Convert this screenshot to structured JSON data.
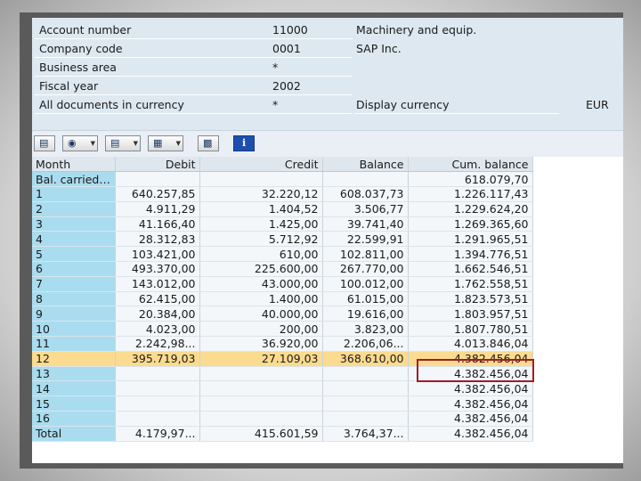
{
  "header": {
    "rows": [
      {
        "label": "Account number",
        "value": "11000",
        "desc": "Machinery and equip."
      },
      {
        "label": "Company code",
        "value": "0001",
        "desc": "SAP Inc."
      },
      {
        "label": "Business area",
        "value": "*",
        "desc": ""
      },
      {
        "label": "Fiscal year",
        "value": "2002",
        "desc": ""
      },
      {
        "label": "All documents in currency",
        "value": "*",
        "desc": "Display currency"
      }
    ],
    "currency": "EUR"
  },
  "toolbar": {
    "icons": [
      "detail-view-icon",
      "filter-icon",
      "export-icon",
      "layout-icon",
      "graphic-icon",
      "info-icon"
    ]
  },
  "table": {
    "columns": [
      "Month",
      "Debit",
      "Credit",
      "Balance",
      "Cum. balance"
    ],
    "rows": [
      [
        "Bal. carried…",
        "",
        "",
        "",
        "618.079,70"
      ],
      [
        "1",
        "640.257,85",
        "32.220,12",
        "608.037,73",
        "1.226.117,43"
      ],
      [
        "2",
        "4.911,29",
        "1.404,52",
        "3.506,77",
        "1.229.624,20"
      ],
      [
        "3",
        "41.166,40",
        "1.425,00",
        "39.741,40",
        "1.269.365,60"
      ],
      [
        "4",
        "28.312,83",
        "5.712,92",
        "22.599,91",
        "1.291.965,51"
      ],
      [
        "5",
        "103.421,00",
        "610,00",
        "102.811,00",
        "1.394.776,51"
      ],
      [
        "6",
        "493.370,00",
        "225.600,00",
        "267.770,00",
        "1.662.546,51"
      ],
      [
        "7",
        "143.012,00",
        "43.000,00",
        "100.012,00",
        "1.762.558,51"
      ],
      [
        "8",
        "62.415,00",
        "1.400,00",
        "61.015,00",
        "1.823.573,51"
      ],
      [
        "9",
        "20.384,00",
        "40.000,00",
        "19.616,00",
        "1.803.957,51"
      ],
      [
        "10",
        "4.023,00",
        "200,00",
        "3.823,00",
        "1.807.780,51"
      ],
      [
        "11",
        "2.242,98...",
        "36.920,00",
        "2.206,06...",
        "4.013.846,04"
      ],
      [
        "12",
        "395.719,03",
        "27.109,03",
        "368.610,00",
        "4.382.456,04"
      ],
      [
        "13",
        "",
        "",
        "",
        "4.382.456,04"
      ],
      [
        "14",
        "",
        "",
        "",
        "4.382.456,04"
      ],
      [
        "15",
        "",
        "",
        "",
        "4.382.456,04"
      ],
      [
        "16",
        "",
        "",
        "",
        "4.382.456,04"
      ],
      [
        "Total",
        "4.179,97...",
        "415.601,59",
        "3.764,37...",
        "4.382.456,04"
      ]
    ],
    "highlighted_row": 12,
    "highlight_color": "#fbdb8f",
    "month_column_color": "#a9dcef",
    "marked_cell_border_color": "#a11d24"
  }
}
